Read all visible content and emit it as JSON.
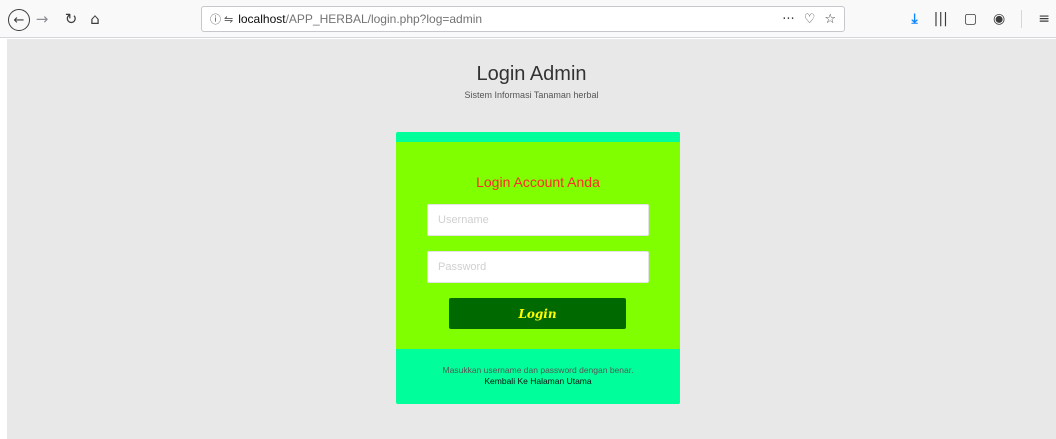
{
  "browser": {
    "url_host": "localhost",
    "url_path": "/APP_HERBAL/login.php?log=admin",
    "icons": {
      "back": "←",
      "forward": "→",
      "reload": "↻",
      "home": "⌂",
      "info": "ⓘ",
      "permissions": "⇋",
      "more": "···",
      "pocket": "♡",
      "bookmark": "☆",
      "download": "⤓",
      "library": "|||",
      "sidebar": "▢",
      "account": "◉",
      "menu": "≡"
    }
  },
  "header": {
    "title": "Login Admin",
    "subtitle": "Sistem Informasi Tanaman herbal"
  },
  "form": {
    "heading": "Login Account Anda",
    "username_placeholder": "Username",
    "password_placeholder": "Password",
    "login_label": "Login"
  },
  "footer": {
    "text": "Masukkan username dan password dengan benar.",
    "link": "Kembali Ke Halaman Utama"
  },
  "colors": {
    "card_green": "#80ff00",
    "accent_mint": "#00ff9b",
    "button": "#006a00",
    "button_text": "#ffff00",
    "heading_red": "#ff2a2a",
    "page_bg": "#e8e8e8"
  }
}
